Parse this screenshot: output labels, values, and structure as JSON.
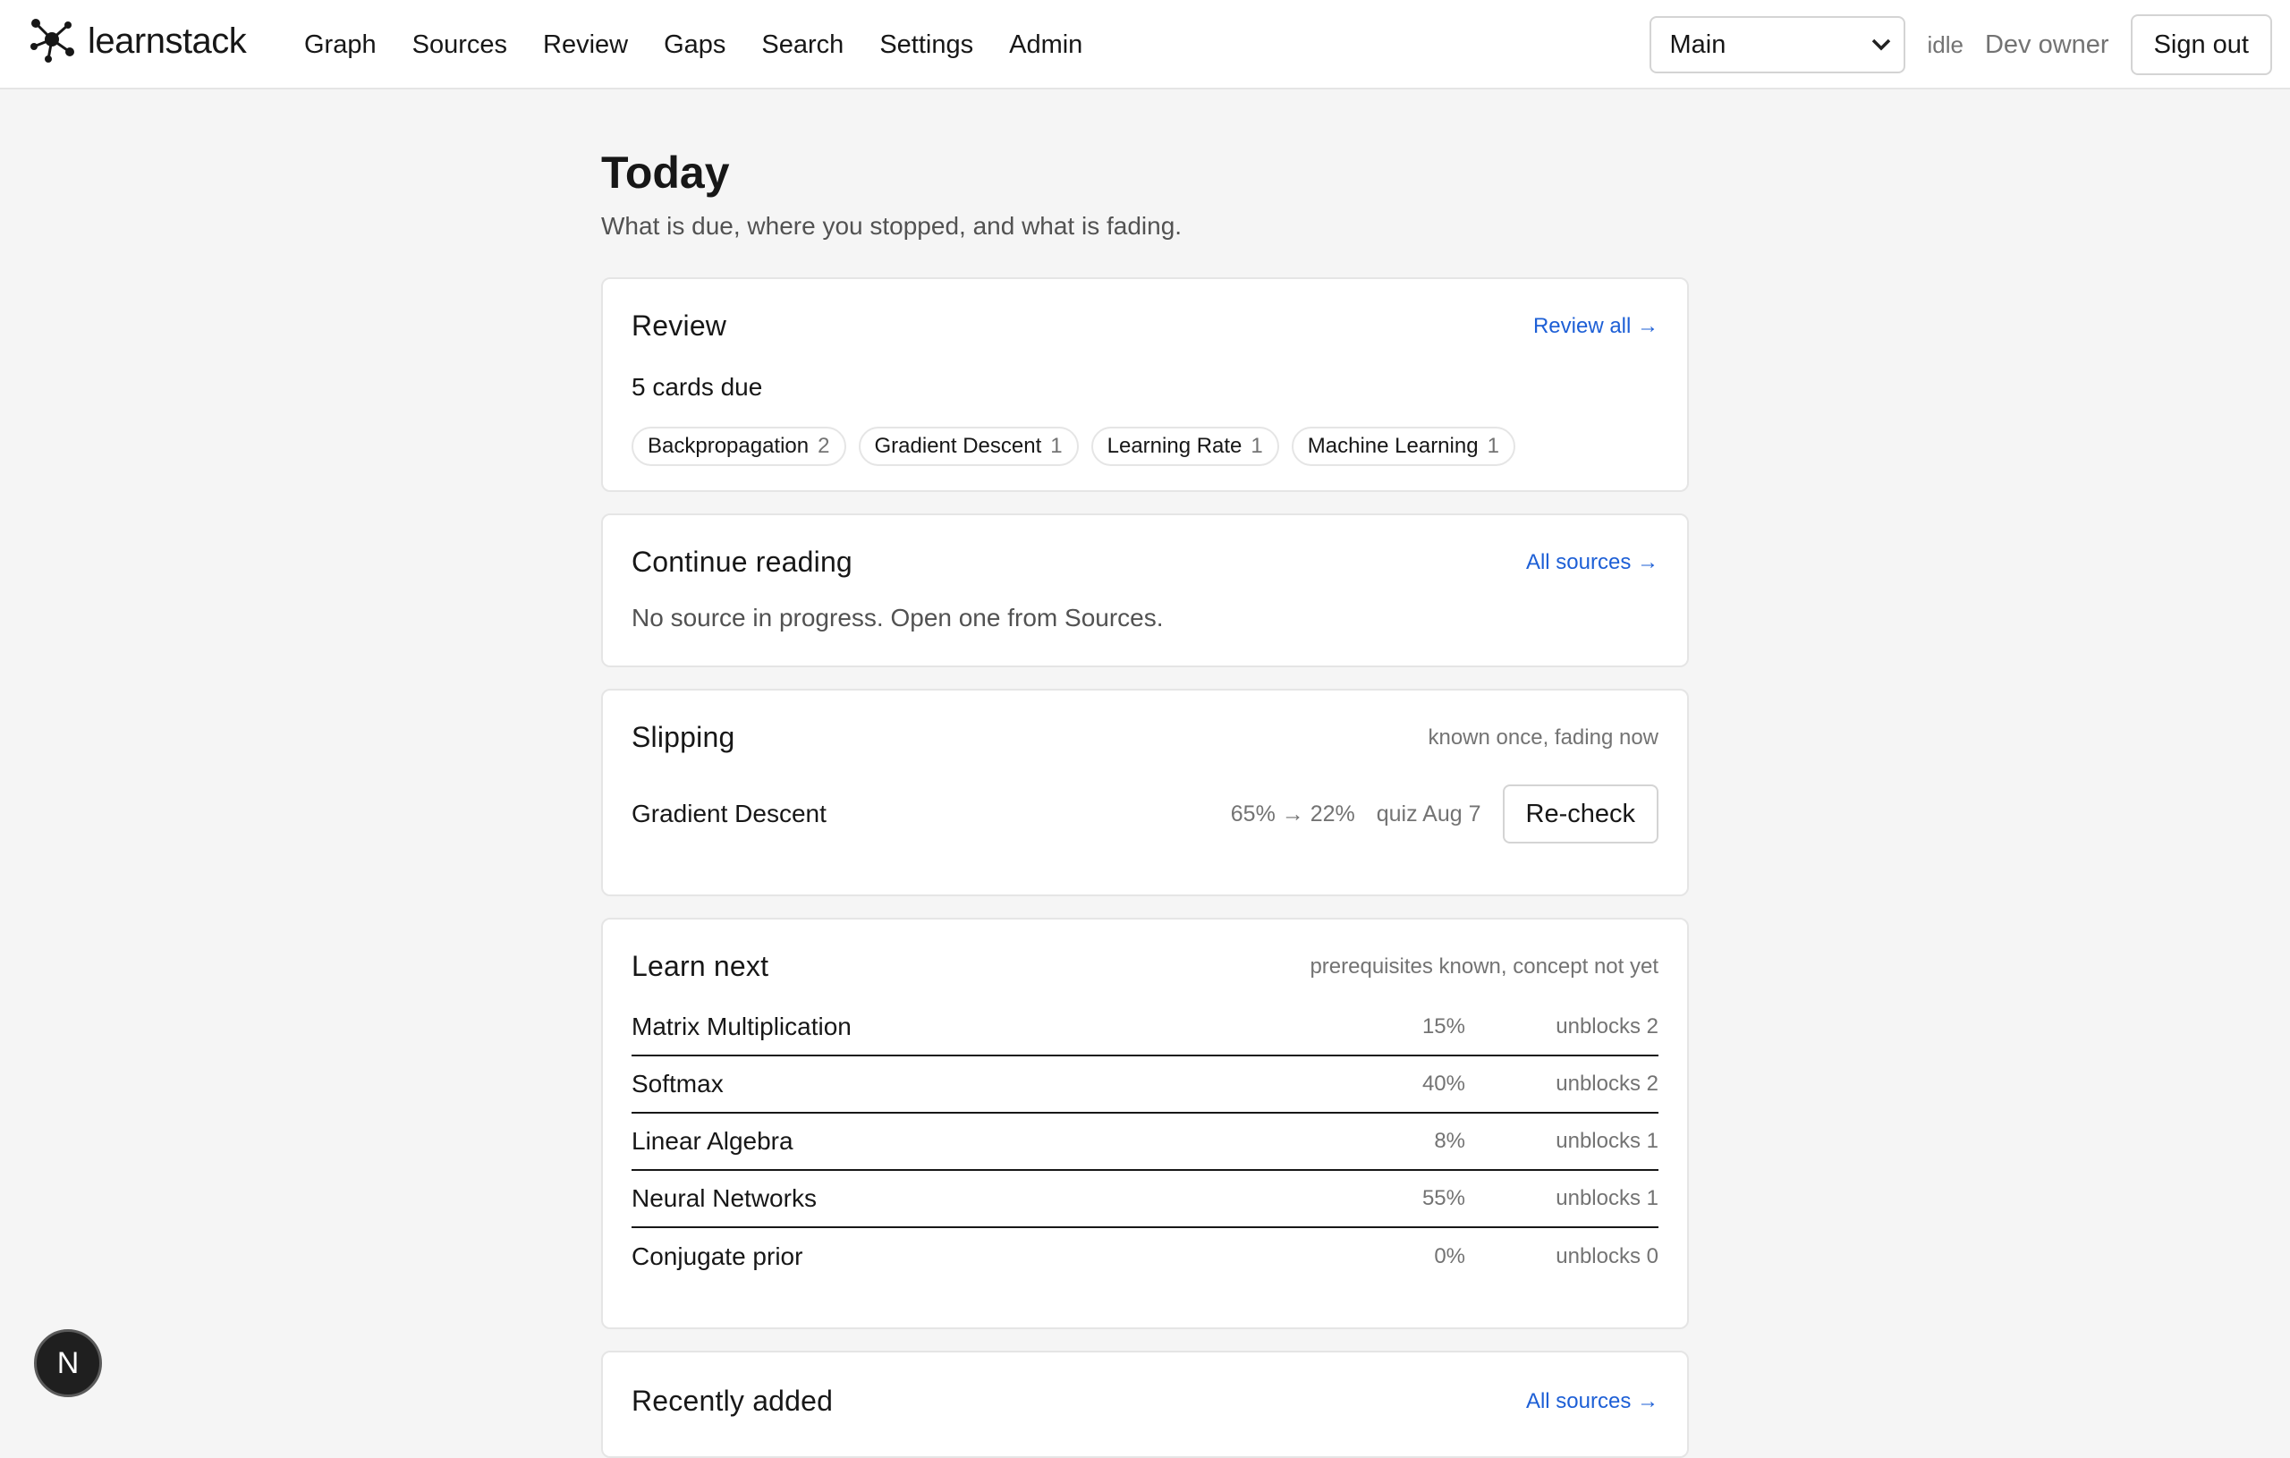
{
  "app": {
    "name": "learnstack"
  },
  "nav": {
    "items": [
      {
        "label": "Graph"
      },
      {
        "label": "Sources"
      },
      {
        "label": "Review"
      },
      {
        "label": "Gaps"
      },
      {
        "label": "Search"
      },
      {
        "label": "Settings"
      },
      {
        "label": "Admin"
      }
    ]
  },
  "header": {
    "workspace_select": "Main",
    "status": "idle",
    "user": "Dev owner",
    "sign_out": "Sign out"
  },
  "page": {
    "title": "Today",
    "subtitle": "What is due, where you stopped, and what is fading."
  },
  "review": {
    "title": "Review",
    "link": "Review all →",
    "due_text": "5 cards due",
    "chips": [
      {
        "label": "Backpropagation",
        "count": "2"
      },
      {
        "label": "Gradient Descent",
        "count": "1"
      },
      {
        "label": "Learning Rate",
        "count": "1"
      },
      {
        "label": "Machine Learning",
        "count": "1"
      }
    ]
  },
  "continue_reading": {
    "title": "Continue reading",
    "link": "All sources →",
    "empty": "No source in progress. Open one from Sources."
  },
  "slipping": {
    "title": "Slipping",
    "hint": "known once, fading now",
    "item": {
      "name": "Gradient Descent",
      "change": "65% → 22%",
      "quiz": "quiz Aug 7",
      "button": "Re-check"
    }
  },
  "learn_next": {
    "title": "Learn next",
    "hint": "prerequisites known, concept not yet",
    "rows": [
      {
        "name": "Matrix Multiplication",
        "pct": "15%",
        "unblocks": "unblocks 2"
      },
      {
        "name": "Softmax",
        "pct": "40%",
        "unblocks": "unblocks 2"
      },
      {
        "name": "Linear Algebra",
        "pct": "8%",
        "unblocks": "unblocks 1"
      },
      {
        "name": "Neural Networks",
        "pct": "55%",
        "unblocks": "unblocks 1"
      },
      {
        "name": "Conjugate prior",
        "pct": "0%",
        "unblocks": "unblocks 0"
      }
    ]
  },
  "recently_added": {
    "title": "Recently added",
    "link": "All sources →"
  },
  "fab": {
    "label": "N"
  },
  "colors": {
    "accent": "#1d5fd6",
    "background": "#f5f5f5",
    "card": "#ffffff"
  }
}
